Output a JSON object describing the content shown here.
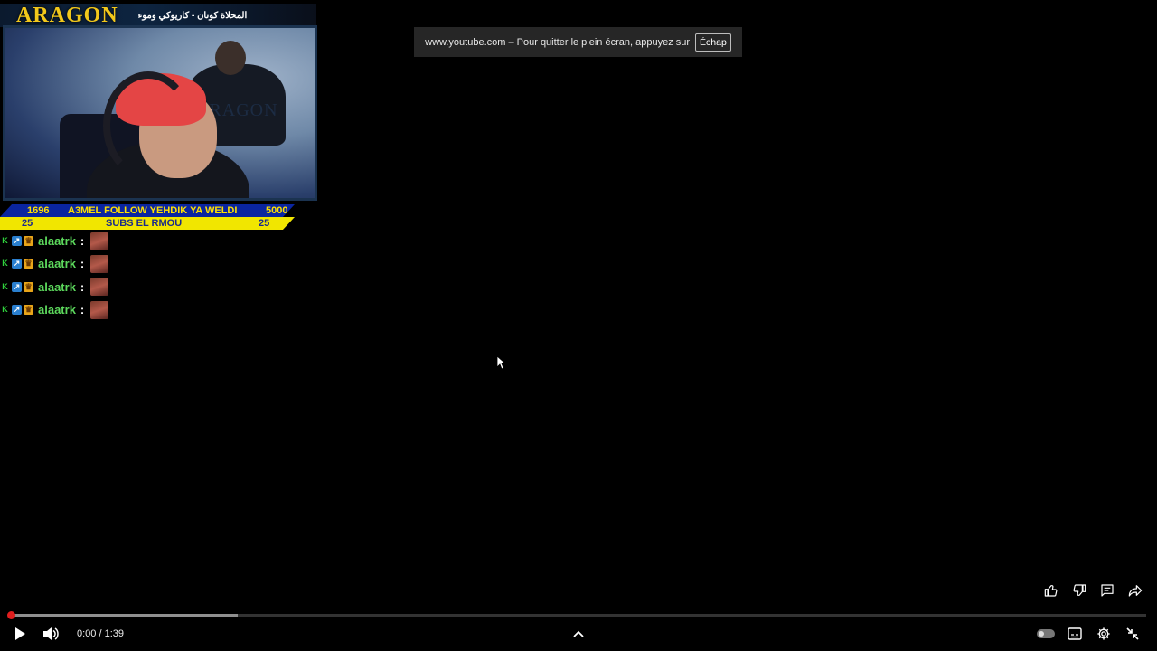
{
  "notice": {
    "text": "www.youtube.com – Pour quitter le plein écran, appuyez sur",
    "key": "Échap"
  },
  "overlay": {
    "logo": "ARAGON",
    "ticker": "المحلاة كونان - كاريوكي وموء",
    "wall_logo": "ARAGON",
    "stats": {
      "left": "1696",
      "center": "A3MEL FOLLOW YEHDIK YA WELDI",
      "right": "5000"
    },
    "subs": {
      "left": "25",
      "center": "SUBS EL RMOU",
      "right": "25"
    }
  },
  "chat": [
    {
      "user": "alaatrk",
      "sep": ":"
    },
    {
      "user": "alaatrk",
      "sep": ":"
    },
    {
      "user": "alaatrk",
      "sep": ":"
    },
    {
      "user": "alaatrk",
      "sep": ":"
    }
  ],
  "player": {
    "time": "0:00 / 1:39",
    "progress_fraction": 0,
    "buffer_fraction": 0.2
  },
  "colors": {
    "accent": "#e01e1e",
    "chat_user": "#5cd85c",
    "logo": "#f2c81b"
  }
}
